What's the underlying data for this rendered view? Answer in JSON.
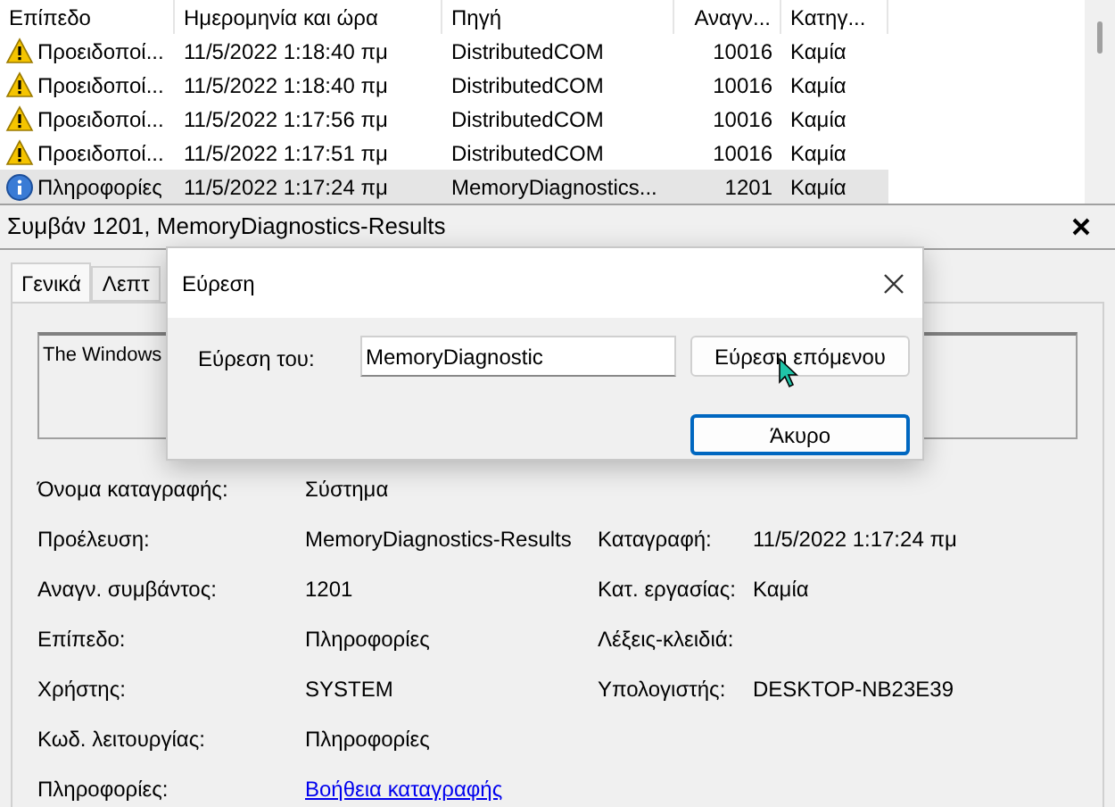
{
  "table": {
    "columns": [
      "Επίπεδο",
      "Ημερομηνία και ώρα",
      "Πηγή",
      "Αναγν...",
      "Κατηγ..."
    ],
    "rows": [
      {
        "kind": "warning",
        "selected": false,
        "cells": [
          "Προειδοποί...",
          "11/5/2022 1:18:40 πμ",
          "DistributedCOM",
          "10016",
          "Καμία"
        ]
      },
      {
        "kind": "warning",
        "selected": false,
        "cells": [
          "Προειδοποί...",
          "11/5/2022 1:18:40 πμ",
          "DistributedCOM",
          "10016",
          "Καμία"
        ]
      },
      {
        "kind": "warning",
        "selected": false,
        "cells": [
          "Προειδοποί...",
          "11/5/2022 1:17:56 πμ",
          "DistributedCOM",
          "10016",
          "Καμία"
        ]
      },
      {
        "kind": "warning",
        "selected": false,
        "cells": [
          "Προειδοποί...",
          "11/5/2022 1:17:51 πμ",
          "DistributedCOM",
          "10016",
          "Καμία"
        ]
      },
      {
        "kind": "info",
        "selected": true,
        "cells": [
          "Πληροφορίες",
          "11/5/2022 1:17:24 πμ",
          "MemoryDiagnostics...",
          "1201",
          "Καμία"
        ]
      }
    ]
  },
  "details": {
    "title": "Συμβάν 1201, MemoryDiagnostics-Results",
    "tabs": [
      {
        "label": "Γενικά",
        "selected": true
      },
      {
        "label": "Λεπτ",
        "selected": false
      }
    ],
    "description": "The Windows",
    "fields": [
      {
        "label": "Όνομα καταγραφής:",
        "value": "Σύστημα"
      },
      {
        "label": "Προέλευση:",
        "value": "MemoryDiagnostics-Results",
        "label2": "Καταγραφή:",
        "value2": "11/5/2022 1:17:24 πμ"
      },
      {
        "label": "Αναγν. συμβάντος:",
        "value": "1201",
        "label2": "Κατ. εργασίας:",
        "value2": "Καμία"
      },
      {
        "label": "Επίπεδο:",
        "value": "Πληροφορίες",
        "label2": "Λέξεις-κλειδιά:"
      },
      {
        "label": "Χρήστης:",
        "value": "SYSTEM",
        "label2": "Υπολογιστής:",
        "value2": "DESKTOP-NB23E39"
      },
      {
        "label": "Κωδ. λειτουργίας:",
        "value": "Πληροφορίες"
      },
      {
        "label": "Πληροφορίες:",
        "link": "Βοήθεια καταγραφής"
      }
    ]
  },
  "dialog": {
    "title": "Εύρεση",
    "label": "Εύρεση του:",
    "value": "MemoryDiagnostic",
    "buttons": [
      {
        "label": "Εύρεση επόμενου",
        "kind": "normal"
      },
      {
        "label": "Άκυρο",
        "kind": "default"
      }
    ]
  }
}
